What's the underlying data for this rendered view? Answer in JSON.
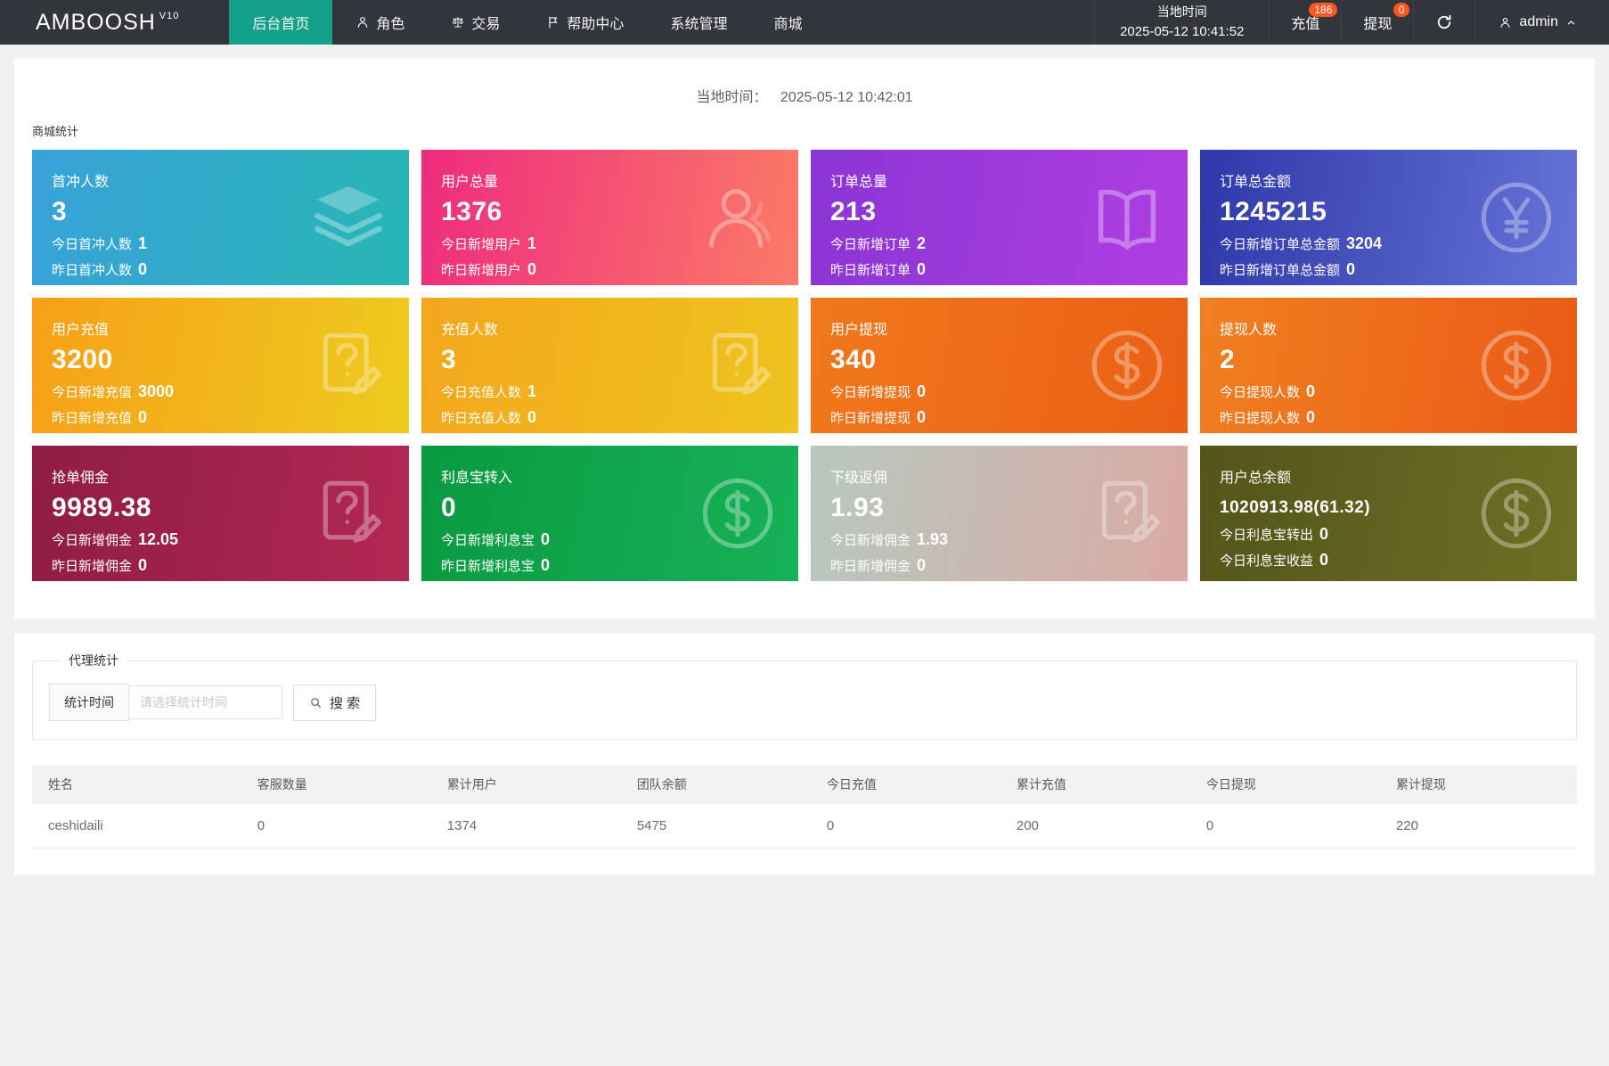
{
  "brand": {
    "name": "AMBOOSH",
    "version": "V10"
  },
  "nav": {
    "items": [
      {
        "name": "home",
        "label": "后台首页",
        "active": true
      },
      {
        "name": "roles",
        "label": "角色",
        "icon": "person-icon"
      },
      {
        "name": "trade",
        "label": "交易",
        "icon": "scales-icon"
      },
      {
        "name": "help-center",
        "label": "帮助中心",
        "icon": "flag-icon"
      },
      {
        "name": "system",
        "label": "系统管理"
      },
      {
        "name": "mall",
        "label": "商城"
      }
    ],
    "local_time_label": "当地时间",
    "local_time_value": "2025-05-12 10:41:52",
    "recharge_label": "充值",
    "recharge_badge": "186",
    "withdraw_label": "提现",
    "withdraw_badge": "0",
    "badge_color": "#ff5722",
    "active_color": "#13a18a",
    "user": "admin"
  },
  "header": {
    "local_time_label": "当地时间：",
    "local_time_value": "2025-05-12 10:42:01",
    "section_title": "商城统计"
  },
  "cards": [
    {
      "name": "first-recharge-users",
      "title": "首冲人数",
      "value": "3",
      "lines": [
        {
          "label": "今日首冲人数",
          "value": "1"
        },
        {
          "label": "昨日首冲人数",
          "value": "0"
        }
      ],
      "icon": "layers-icon",
      "gradient_from": "#38a2d9",
      "gradient_to": "#28b6b4"
    },
    {
      "name": "total-users",
      "title": "用户总量",
      "value": "1376",
      "lines": [
        {
          "label": "今日新增用户",
          "value": "1"
        },
        {
          "label": "昨日新增用户",
          "value": "0"
        }
      ],
      "icon": "user-icon",
      "gradient_from": "#ee2b7e",
      "gradient_to": "#fb7b66"
    },
    {
      "name": "total-orders",
      "title": "订单总量",
      "value": "213",
      "lines": [
        {
          "label": "今日新增订单",
          "value": "2"
        },
        {
          "label": "昨日新增订单",
          "value": "0"
        }
      ],
      "icon": "book-icon",
      "gradient_from": "#8a35d4",
      "gradient_to": "#b03ee2"
    },
    {
      "name": "total-order-amount",
      "title": "订单总金额",
      "value": "1245215",
      "lines": [
        {
          "label": "今日新增订单总金额",
          "value": "3204"
        },
        {
          "label": "昨日新增订单总金额",
          "value": "0"
        }
      ],
      "icon": "yen-circle-icon",
      "gradient_from": "#2e37a8",
      "gradient_to": "#6674d8"
    },
    {
      "name": "user-recharge",
      "title": "用户充值",
      "value": "3200",
      "lines": [
        {
          "label": "今日新增充值",
          "value": "3000"
        },
        {
          "label": "昨日新增充值",
          "value": "0"
        }
      ],
      "icon": "doc-question-icon",
      "gradient_from": "#f7a018",
      "gradient_to": "#edcb1e"
    },
    {
      "name": "recharge-users",
      "title": "充值人数",
      "value": "3",
      "lines": [
        {
          "label": "今日充值人数",
          "value": "1"
        },
        {
          "label": "昨日充值人数",
          "value": "0"
        }
      ],
      "icon": "doc-question-icon",
      "gradient_from": "#f3a71c",
      "gradient_to": "#eec41e"
    },
    {
      "name": "user-withdraw",
      "title": "用户提现",
      "value": "340",
      "lines": [
        {
          "label": "今日新增提现",
          "value": "0"
        },
        {
          "label": "昨日新增提现",
          "value": "0"
        }
      ],
      "icon": "dollar-circle-icon",
      "gradient_from": "#f1781d",
      "gradient_to": "#ea6014"
    },
    {
      "name": "withdraw-users",
      "title": "提现人数",
      "value": "2",
      "lines": [
        {
          "label": "今日提现人数",
          "value": "0"
        },
        {
          "label": "昨日提现人数",
          "value": "0"
        }
      ],
      "icon": "dollar-circle-icon",
      "gradient_from": "#f17f20",
      "gradient_to": "#e95a16"
    },
    {
      "name": "order-commission",
      "title": "抢单佣金",
      "value": "9989.38",
      "lines": [
        {
          "label": "今日新增佣金",
          "value": "12.05"
        },
        {
          "label": "昨日新增佣金",
          "value": "0"
        }
      ],
      "icon": "doc-question-icon",
      "gradient_from": "#8e1c44",
      "gradient_to": "#b22853"
    },
    {
      "name": "interest-transfer-in",
      "title": "利息宝转入",
      "value": "0",
      "lines": [
        {
          "label": "今日新增利息宝",
          "value": "0"
        },
        {
          "label": "昨日新增利息宝",
          "value": "0"
        }
      ],
      "icon": "dollar-circle-icon",
      "gradient_from": "#0a9a41",
      "gradient_to": "#17b158"
    },
    {
      "name": "sub-rebate",
      "title": "下级返佣",
      "value": "1.93",
      "lines": [
        {
          "label": "今日新增佣金",
          "value": "1.93"
        },
        {
          "label": "昨日新增佣金",
          "value": "0"
        }
      ],
      "icon": "doc-question-icon",
      "gradient_from": "#b7c8bf",
      "gradient_to": "#daaaa4"
    },
    {
      "name": "user-total-balance",
      "title": "用户总余额",
      "value": "1020913.98(61.32)",
      "lines": [
        {
          "label": "今日利息宝转出",
          "value": "0"
        },
        {
          "label": "今日利息宝收益",
          "value": "0"
        }
      ],
      "icon": "dollar-circle-icon",
      "gradient_from": "#53551b",
      "gradient_to": "#6e7025"
    }
  ],
  "agent_panel": {
    "legend": "代理统计",
    "time_label": "统计时间",
    "time_placeholder": "请选择统计时间",
    "search_label": "搜 索"
  },
  "table": {
    "columns": [
      "姓名",
      "客服数量",
      "累计用户",
      "团队余额",
      "今日充值",
      "累计充值",
      "今日提现",
      "累计提现"
    ],
    "rows": [
      [
        "ceshidaili",
        "0",
        "1374",
        "5475",
        "0",
        "200",
        "0",
        "220"
      ]
    ]
  }
}
